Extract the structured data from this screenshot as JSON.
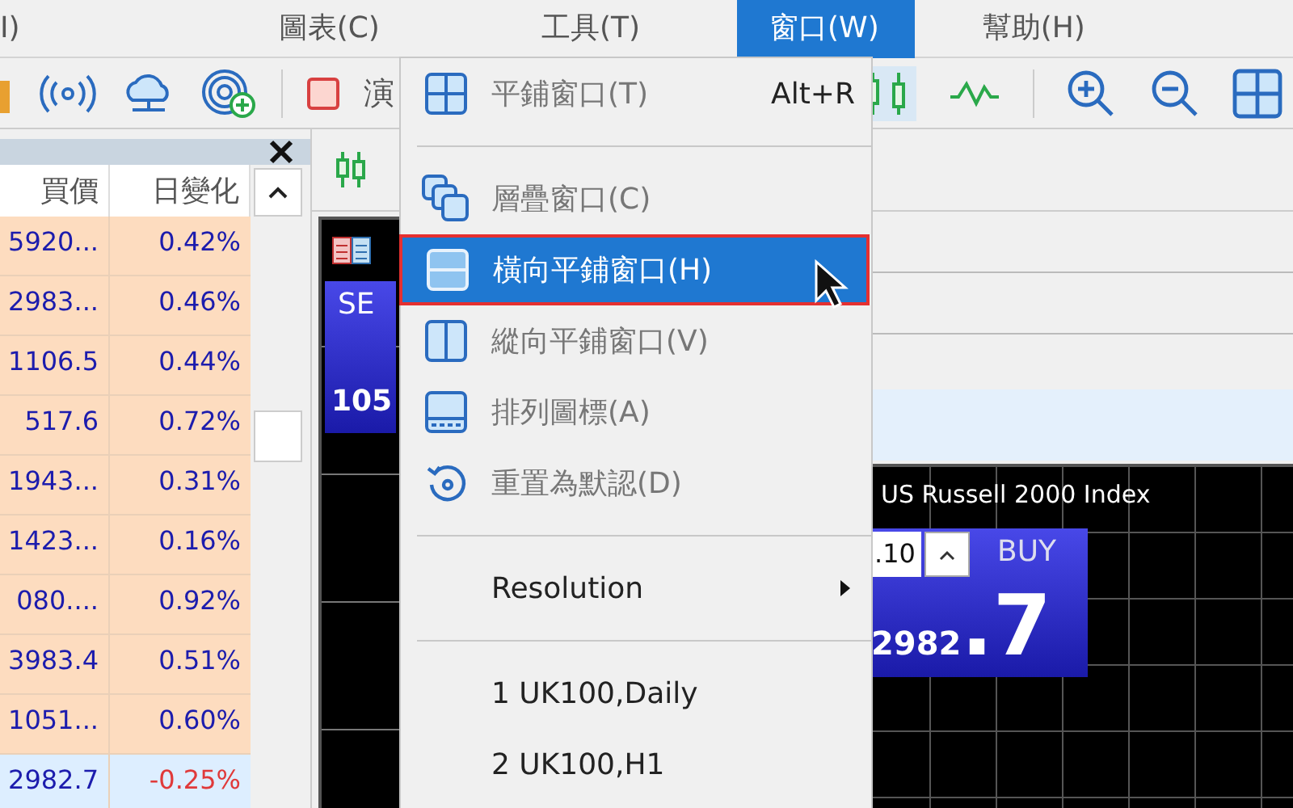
{
  "menu_bar": [
    {
      "label": "I)",
      "selected": false
    },
    {
      "label": "圖表(C)",
      "selected": false
    },
    {
      "label": "工具(T)",
      "selected": false
    },
    {
      "label": "窗口(W)",
      "selected": true
    },
    {
      "label": "幫助(H)",
      "selected": false
    }
  ],
  "toolbar": {
    "partial_label": "演"
  },
  "market_watch": {
    "columns": [
      "買價",
      "日變化"
    ],
    "rows": [
      {
        "bid": "5920...",
        "change": "0.42%",
        "color": "#1c1cad",
        "selected": false
      },
      {
        "bid": "2983...",
        "change": "0.46%",
        "color": "#1c1cad",
        "selected": false
      },
      {
        "bid": "1106.5",
        "change": "0.44%",
        "color": "#1c1cad",
        "selected": false
      },
      {
        "bid": "517.6",
        "change": "0.72%",
        "color": "#1c1cad",
        "selected": false
      },
      {
        "bid": "1943...",
        "change": "0.31%",
        "color": "#1c1cad",
        "selected": false
      },
      {
        "bid": "1423...",
        "change": "0.16%",
        "color": "#1c1cad",
        "selected": false
      },
      {
        "bid": "080....",
        "change": "0.92%",
        "color": "#1c1cad",
        "selected": false
      },
      {
        "bid": "3983.4",
        "change": "0.51%",
        "color": "#1c1cad",
        "selected": false
      },
      {
        "bid": "1051...",
        "change": "0.60%",
        "color": "#1c1cad",
        "selected": false
      },
      {
        "bid": "2982.7",
        "change": "-0.25%",
        "color": "#e03a3a",
        "selected": true
      }
    ]
  },
  "chart_left": {
    "sell_label": "SE",
    "price": "105"
  },
  "chart_right": {
    "title": "US Russell 2000 Index",
    "volume": ".10",
    "buy_label": "BUY",
    "price_small": "2982",
    "price_large": ".7"
  },
  "window_menu": [
    {
      "kind": "command",
      "label": "平鋪窗口(T)",
      "shortcut": "Alt+R",
      "disabled": true,
      "selected": false
    },
    {
      "kind": "separator"
    },
    {
      "kind": "command",
      "label": "層疊窗口(C)",
      "disabled": true,
      "selected": false
    },
    {
      "kind": "command",
      "label": "橫向平鋪窗口(H)",
      "disabled": true,
      "selected": true
    },
    {
      "kind": "command",
      "label": "縱向平鋪窗口(V)",
      "disabled": true,
      "selected": false
    },
    {
      "kind": "command",
      "label": "排列圖標(A)",
      "disabled": true,
      "selected": false
    },
    {
      "kind": "command",
      "label": "重置為默認(D)",
      "disabled": true,
      "selected": false
    },
    {
      "kind": "separator"
    },
    {
      "kind": "submenu",
      "label": "Resolution",
      "disabled": false,
      "selected": false
    },
    {
      "kind": "separator"
    },
    {
      "kind": "command",
      "label": "1 UK100,Daily",
      "disabled": false,
      "selected": false
    },
    {
      "kind": "command",
      "label": "2 UK100,H1",
      "disabled": false,
      "selected": false
    }
  ]
}
